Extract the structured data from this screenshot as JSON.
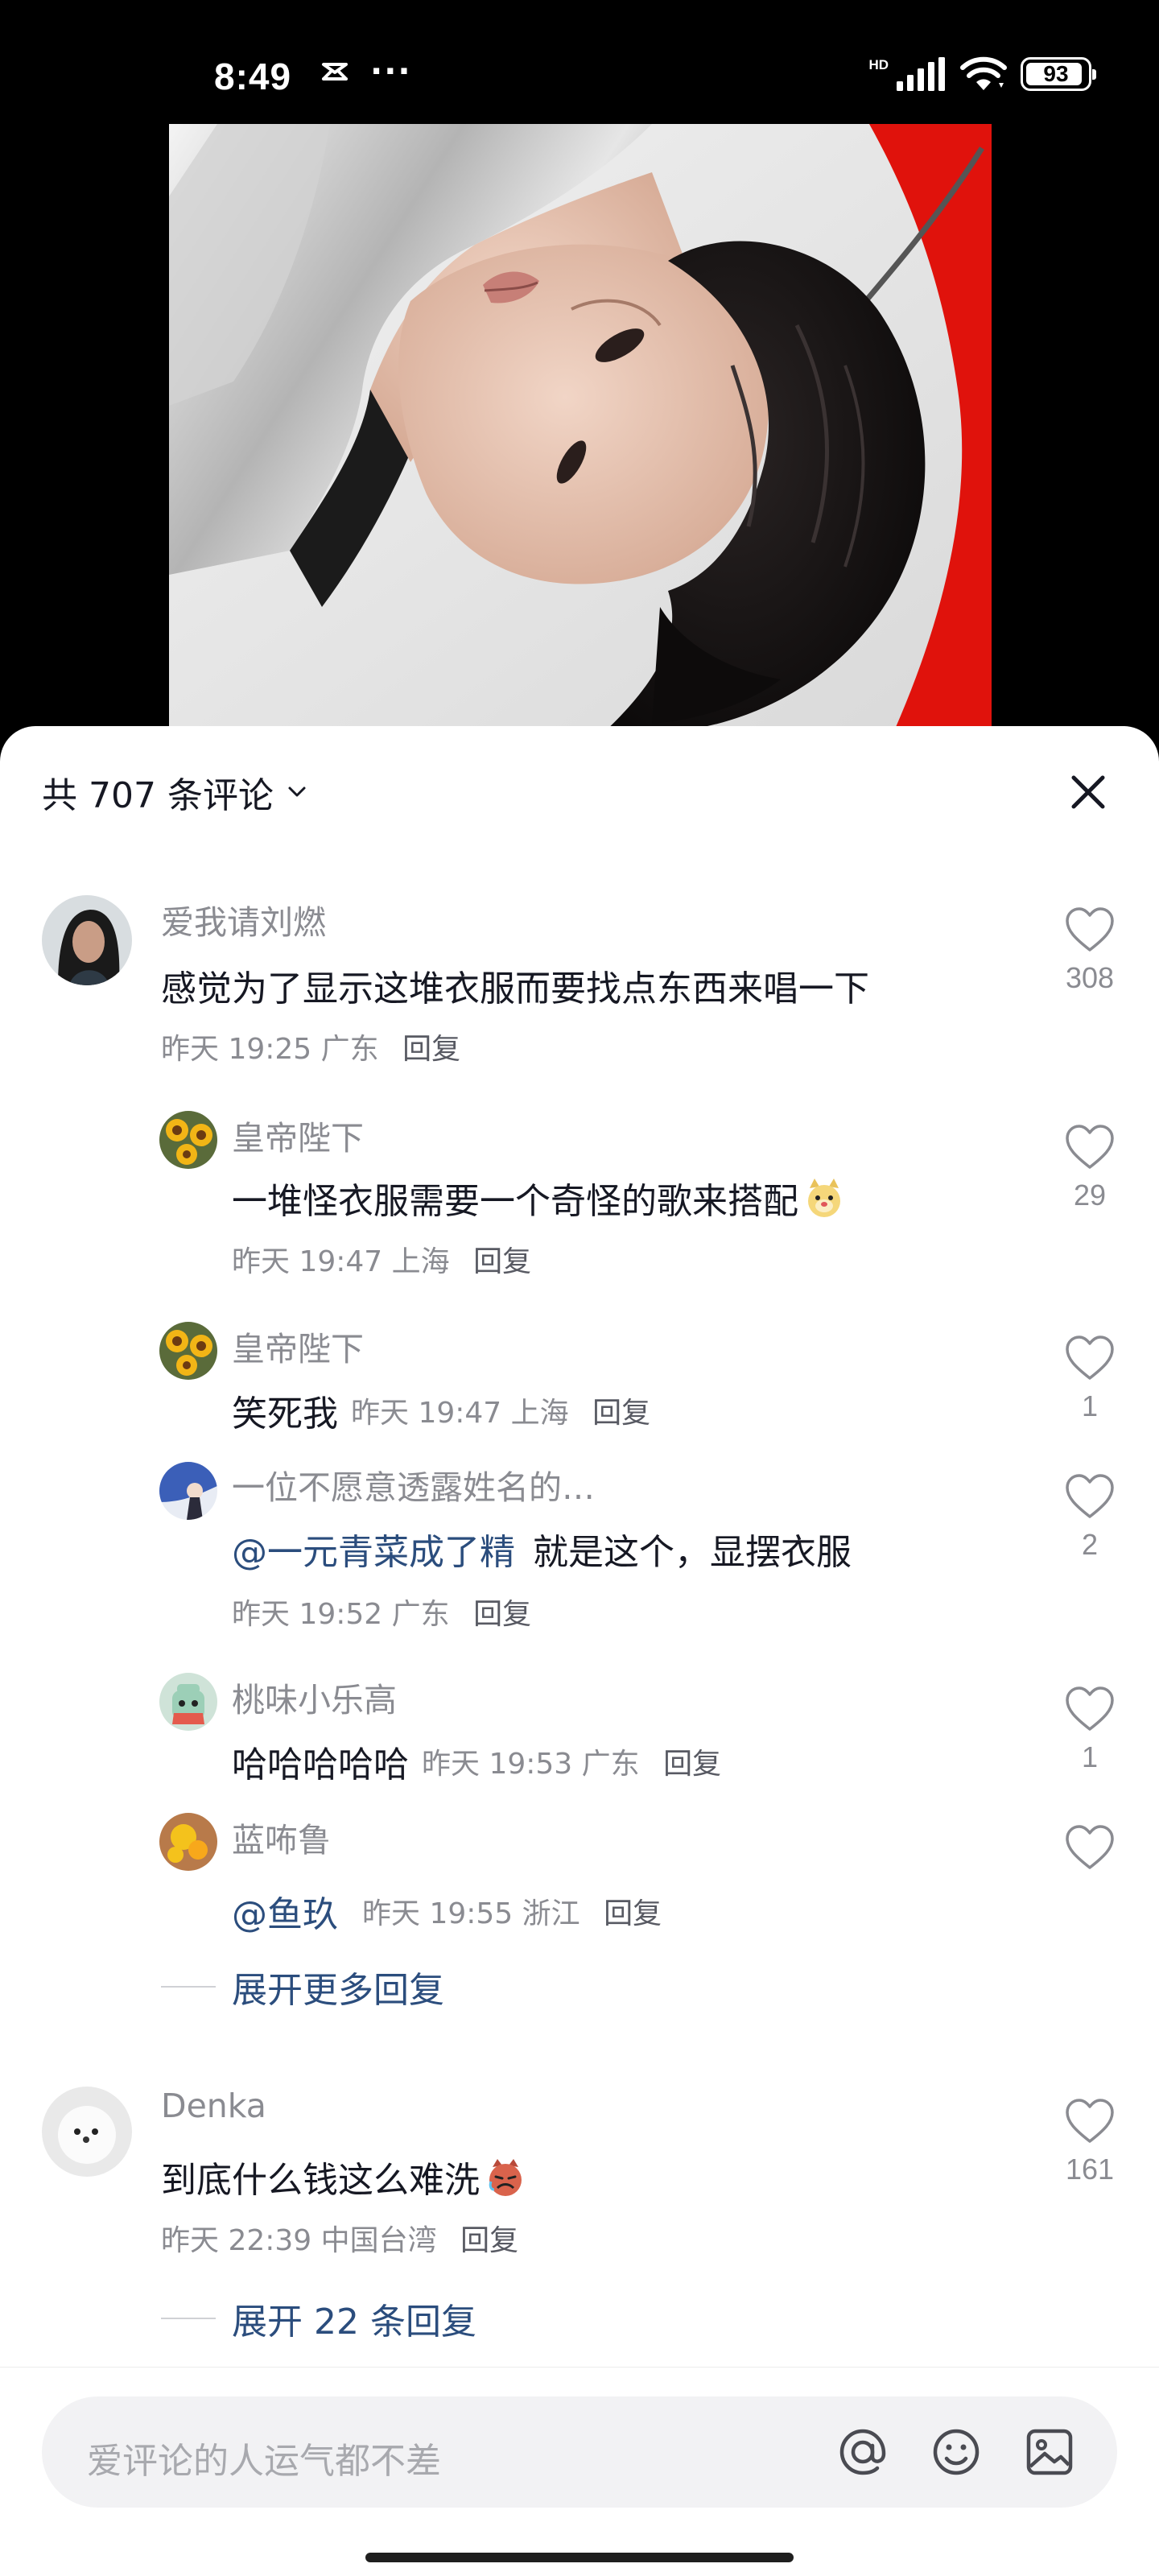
{
  "status_bar": {
    "time": "8:49",
    "more": "···",
    "network": "HD",
    "battery": "93",
    "battery_level": 0.93
  },
  "sheet": {
    "count_label": "共 707 条评论"
  },
  "comments": [
    {
      "user": "爱我请刘燃",
      "text": "感觉为了显示这堆衣服而要找点东西来唱一下",
      "time": "昨天 19:25",
      "location": "广东",
      "reply": "回复",
      "likes": "308"
    },
    {
      "user": "皇帝陛下",
      "text": "一堆怪衣服需要一个奇怪的歌来搭配",
      "time": "昨天 19:47",
      "location": "上海",
      "reply": "回复",
      "likes": "29"
    },
    {
      "user": "皇帝陛下",
      "text": "笑死我",
      "time": "昨天 19:47",
      "location": "上海",
      "reply": "回复",
      "likes": "1"
    },
    {
      "user": "一位不愿意透露姓名的…",
      "mention": "@一元青菜成了精",
      "text": "就是这个，显摆衣服",
      "time": "昨天 19:52",
      "location": "广东",
      "reply": "回复",
      "likes": "2"
    },
    {
      "user": "桃味小乐高",
      "text": "哈哈哈哈哈",
      "time": "昨天 19:53",
      "location": "广东",
      "reply": "回复",
      "likes": "1"
    },
    {
      "user": "蓝咘鲁",
      "mention": "@鱼玖",
      "time": "昨天 19:55",
      "location": "浙江",
      "reply": "回复",
      "likes": ""
    },
    {
      "user": "Denka",
      "text": "到底什么钱这么难洗",
      "time": "昨天 22:39",
      "location": "中国台湾",
      "reply": "回复",
      "likes": "161"
    }
  ],
  "expand": {
    "more_replies": "展开更多回复",
    "replies_22": "展开 22 条回复"
  },
  "input": {
    "placeholder": "爱评论的人运气都不差"
  },
  "icons": {
    "like": "heart-outline-icon",
    "close": "close-icon",
    "at": "at-icon",
    "emoji": "smiley-icon",
    "image": "image-icon"
  },
  "colors": {
    "mention": "#2b4d7d",
    "text": "#161823",
    "meta": "#8a8b91"
  }
}
